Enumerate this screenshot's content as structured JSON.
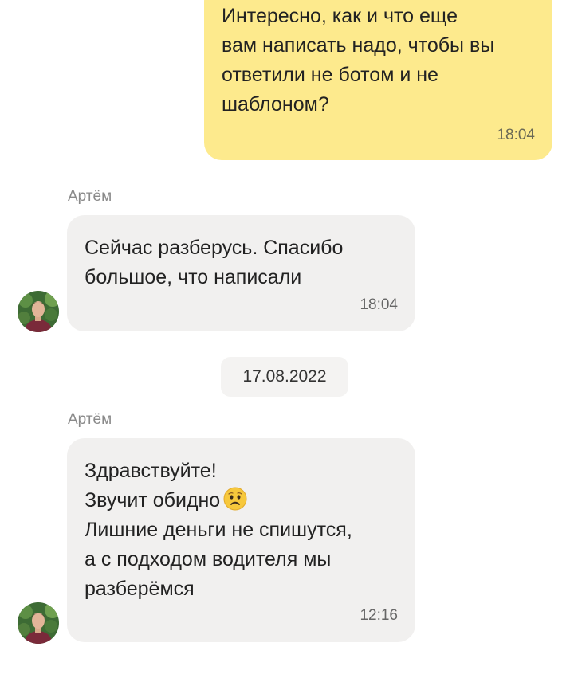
{
  "messages": [
    {
      "direction": "outgoing",
      "text": "Интересно, как и что еще\nвам написать надо, чтобы вы\nответили не ботом и не\nшаблоном?",
      "time": "18:04"
    },
    {
      "direction": "incoming",
      "sender": "Артём",
      "text": "Сейчас разберусь. Спасибо\nбольшое, что написали",
      "time": "18:04"
    },
    {
      "direction": "incoming",
      "sender": "Артём",
      "text_line1": "Здравствуйте!",
      "text_line2": "Звучит обидно",
      "emoji": "worried-face-emoji",
      "text_rest": "Лишние деньги не спишутся,\nа с подходом водителя мы\nразберёмся",
      "time": "12:16"
    }
  ],
  "date_separator": "17.08.2022",
  "colors": {
    "outgoing_bubble": "#fdea8d",
    "incoming_bubble": "#f1f0ef",
    "sender_name": "#8a8a8a"
  }
}
